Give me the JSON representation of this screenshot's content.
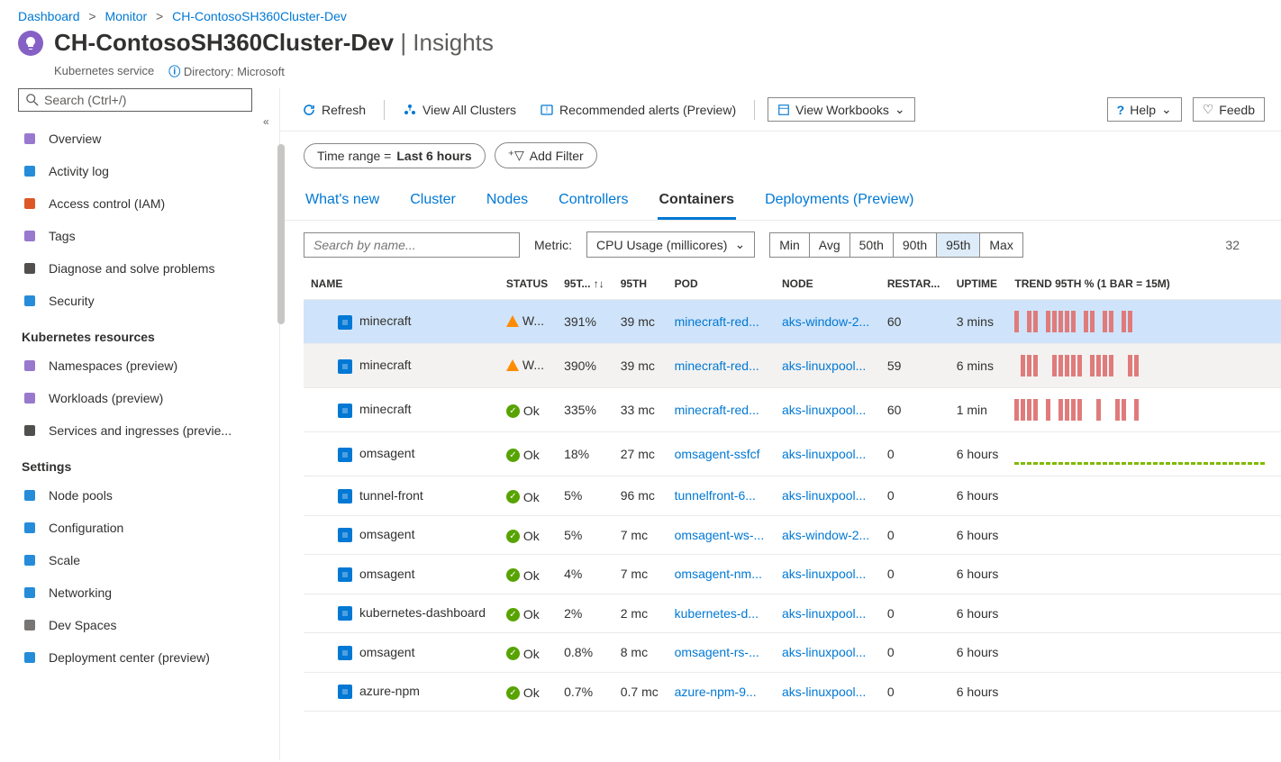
{
  "breadcrumb": [
    "Dashboard",
    "Monitor",
    "CH-ContosoSH360Cluster-Dev"
  ],
  "page_title": "CH-ContosoSH360Cluster-Dev",
  "page_title_suffix": "Insights",
  "service_type": "Kubernetes service",
  "directory_label": "Directory: Microsoft",
  "search_placeholder": "Search (Ctrl+/)",
  "sidebar": {
    "items_top": [
      {
        "icon": "overview-icon",
        "label": "Overview"
      },
      {
        "icon": "activity-log-icon",
        "label": "Activity log"
      },
      {
        "icon": "access-control-icon",
        "label": "Access control (IAM)"
      },
      {
        "icon": "tags-icon",
        "label": "Tags"
      },
      {
        "icon": "diagnose-icon",
        "label": "Diagnose and solve problems"
      },
      {
        "icon": "security-icon",
        "label": "Security"
      }
    ],
    "section_k8s": "Kubernetes resources",
    "items_k8s": [
      {
        "icon": "namespaces-icon",
        "label": "Namespaces (preview)"
      },
      {
        "icon": "workloads-icon",
        "label": "Workloads (preview)"
      },
      {
        "icon": "services-icon",
        "label": "Services and ingresses (previe..."
      }
    ],
    "section_settings": "Settings",
    "items_settings": [
      {
        "icon": "nodepools-icon",
        "label": "Node pools"
      },
      {
        "icon": "configuration-icon",
        "label": "Configuration"
      },
      {
        "icon": "scale-icon",
        "label": "Scale"
      },
      {
        "icon": "networking-icon",
        "label": "Networking"
      },
      {
        "icon": "devspaces-icon",
        "label": "Dev Spaces"
      },
      {
        "icon": "deployment-center-icon",
        "label": "Deployment center (preview)"
      }
    ]
  },
  "toolbar": {
    "refresh": "Refresh",
    "view_all": "View All Clusters",
    "alerts": "Recommended alerts (Preview)",
    "workbooks": "View Workbooks",
    "help": "Help",
    "feedback": "Feedb"
  },
  "filters": {
    "time_range_prefix": "Time range = ",
    "time_range_value": "Last 6 hours",
    "add_filter": "Add Filter"
  },
  "tabs": [
    "What's new",
    "Cluster",
    "Nodes",
    "Controllers",
    "Containers",
    "Deployments (Preview)"
  ],
  "active_tab": "Containers",
  "query": {
    "search_placeholder": "Search by name...",
    "metric_label": "Metric:",
    "metric_value": "CPU Usage (millicores)",
    "seg": [
      "Min",
      "Avg",
      "50th",
      "90th",
      "95th",
      "Max"
    ],
    "seg_selected": "95th",
    "count": "32"
  },
  "columns": [
    "NAME",
    "STATUS",
    "95T...",
    "95TH",
    "POD",
    "NODE",
    "RESTAR...",
    "UPTIME",
    "TREND 95TH % (1 BAR = 15M)"
  ],
  "sort_indicator": "↑↓",
  "rows": [
    {
      "name": "minecraft",
      "status": "W...",
      "status_type": "warn",
      "p95pct": "391%",
      "p95": "39 mc",
      "pod": "minecraft-red...",
      "node": "aks-window-2...",
      "restarts": "60",
      "uptime": "3 mins",
      "trend": [
        24,
        0,
        24,
        24,
        0,
        24,
        24,
        24,
        24,
        24,
        0,
        24,
        24,
        0,
        24,
        24,
        0,
        24,
        24
      ],
      "sel": true
    },
    {
      "name": "minecraft",
      "status": "W...",
      "status_type": "warn",
      "p95pct": "390%",
      "p95": "39 mc",
      "pod": "minecraft-red...",
      "node": "aks-linuxpool...",
      "restarts": "59",
      "uptime": "6 mins",
      "trend": [
        0,
        24,
        24,
        24,
        0,
        0,
        24,
        24,
        24,
        24,
        24,
        0,
        24,
        24,
        24,
        24,
        0,
        0,
        24,
        24
      ],
      "hov": true
    },
    {
      "name": "minecraft",
      "status": "Ok",
      "status_type": "ok",
      "p95pct": "335%",
      "p95": "33 mc",
      "pod": "minecraft-red...",
      "node": "aks-linuxpool...",
      "restarts": "60",
      "uptime": "1 min",
      "trend": [
        24,
        24,
        24,
        24,
        0,
        24,
        0,
        24,
        24,
        24,
        24,
        0,
        0,
        24,
        0,
        0,
        24,
        24,
        0,
        24
      ]
    },
    {
      "name": "omsagent",
      "status": "Ok",
      "status_type": "ok",
      "p95pct": "18%",
      "p95": "27 mc",
      "pod": "omsagent-ssfcf",
      "node": "aks-linuxpool...",
      "restarts": "0",
      "uptime": "6 hours",
      "trend": "low"
    },
    {
      "name": "tunnel-front",
      "status": "Ok",
      "status_type": "ok",
      "p95pct": "5%",
      "p95": "96 mc",
      "pod": "tunnelfront-6...",
      "node": "aks-linuxpool...",
      "restarts": "0",
      "uptime": "6 hours",
      "trend": []
    },
    {
      "name": "omsagent",
      "status": "Ok",
      "status_type": "ok",
      "p95pct": "5%",
      "p95": "7 mc",
      "pod": "omsagent-ws-...",
      "node": "aks-window-2...",
      "restarts": "0",
      "uptime": "6 hours",
      "trend": []
    },
    {
      "name": "omsagent",
      "status": "Ok",
      "status_type": "ok",
      "p95pct": "4%",
      "p95": "7 mc",
      "pod": "omsagent-nm...",
      "node": "aks-linuxpool...",
      "restarts": "0",
      "uptime": "6 hours",
      "trend": []
    },
    {
      "name": "kubernetes-dashboard",
      "status": "Ok",
      "status_type": "ok",
      "p95pct": "2%",
      "p95": "2 mc",
      "pod": "kubernetes-d...",
      "node": "aks-linuxpool...",
      "restarts": "0",
      "uptime": "6 hours",
      "trend": []
    },
    {
      "name": "omsagent",
      "status": "Ok",
      "status_type": "ok",
      "p95pct": "0.8%",
      "p95": "8 mc",
      "pod": "omsagent-rs-...",
      "node": "aks-linuxpool...",
      "restarts": "0",
      "uptime": "6 hours",
      "trend": []
    },
    {
      "name": "azure-npm",
      "status": "Ok",
      "status_type": "ok",
      "p95pct": "0.7%",
      "p95": "0.7 mc",
      "pod": "azure-npm-9...",
      "node": "aks-linuxpool...",
      "restarts": "0",
      "uptime": "6 hours",
      "trend": []
    }
  ]
}
